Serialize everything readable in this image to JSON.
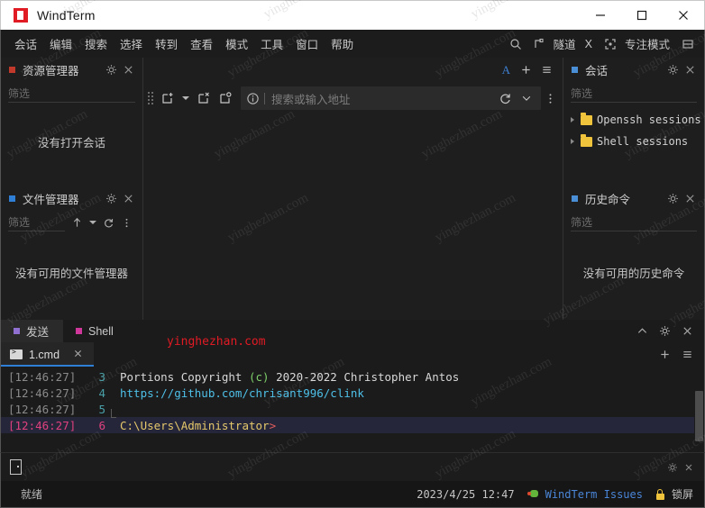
{
  "window": {
    "title": "WindTerm",
    "logo_icon": "windterm-logo-icon",
    "minimize_icon": "minimize-icon",
    "maximize_icon": "maximize-icon",
    "close_icon": "close-icon"
  },
  "menubar": {
    "items": [
      {
        "label": "会话"
      },
      {
        "label": "编辑"
      },
      {
        "label": "搜索"
      },
      {
        "label": "选择"
      },
      {
        "label": "转到"
      },
      {
        "label": "查看"
      },
      {
        "label": "模式"
      },
      {
        "label": "工具"
      },
      {
        "label": "窗口"
      },
      {
        "label": "帮助"
      }
    ],
    "right": {
      "search_icon": "search-icon",
      "tunnel_icon": "tunnel-icon",
      "tunnel_label": "隧道",
      "x_label": "X",
      "focus_icon": "focus-frame-icon",
      "focus_label": "专注模式",
      "layout_icon": "split-layout-icon"
    }
  },
  "explorer": {
    "title": "资源管理器",
    "dot_color": "#c0392b",
    "filter_placeholder": "筛选",
    "empty_text": "没有打开会话",
    "gear_icon": "gear-icon",
    "close_icon": "close-icon"
  },
  "file_manager": {
    "title": "文件管理器",
    "dot_color": "#2f7fd6",
    "filter_placeholder": "筛选",
    "empty_text": "没有可用的文件管理器",
    "gear_icon": "gear-icon",
    "close_icon": "close-icon",
    "up_icon": "arrow-up-icon",
    "dropdown_icon": "chevron-down-icon",
    "refresh_icon": "refresh-icon",
    "more_icon": "more-vertical-icon"
  },
  "sessions": {
    "title": "会话",
    "dot_color": "#2f7fd6",
    "filter_placeholder": "筛选",
    "gear_icon": "gear-icon",
    "close_icon": "close-icon",
    "items": [
      {
        "label": "Openssh sessions",
        "icon": "folder-icon",
        "expander": "chevron-right-icon"
      },
      {
        "label": "Shell sessions",
        "icon": "folder-icon",
        "expander": "chevron-right-icon"
      }
    ]
  },
  "history": {
    "title": "历史命令",
    "dot_color": "#2f7fd6",
    "filter_placeholder": "筛选",
    "empty_text": "没有可用的历史命令",
    "gear_icon": "gear-icon",
    "close_icon": "close-icon"
  },
  "toolbar": {
    "font_icon": "font-A-icon",
    "add_icon": "plus-icon",
    "menu_icon": "hamburger-menu-icon",
    "grip_icon": "drag-grip-icon",
    "new_session_icon": "new-session-icon",
    "new_session_dropdown_icon": "chevron-down-icon",
    "close_session_icon": "close-session-icon",
    "clone_session_icon": "clone-session-icon",
    "info_icon": "info-icon",
    "address_placeholder": "搜索或输入地址",
    "reload_icon": "reload-icon",
    "history_dropdown_icon": "chevron-down-icon",
    "more_icon": "more-vertical-icon"
  },
  "terminal_tabs": {
    "groups": [
      {
        "label": "发送",
        "dot_color": "#8f6fd0",
        "active": true
      },
      {
        "label": "Shell",
        "dot_color": "#d0379a",
        "active": false
      }
    ],
    "collapse_icon": "chevron-up-icon",
    "gear_icon": "gear-icon",
    "close_icon": "close-icon",
    "add_icon": "plus-icon",
    "menu_icon": "hamburger-menu-icon",
    "file_tab": {
      "label": "1.cmd",
      "icon": "cmd-icon",
      "close_icon": "close-icon"
    }
  },
  "terminal": {
    "lines": [
      {
        "timestamp": "[12:46:27]",
        "line_number": "3",
        "gutter": "top",
        "current": false,
        "segments": [
          {
            "text": "Portions Copyright ",
            "color": "#d8d8d8"
          },
          {
            "text": "(c)",
            "color": "#7fd06b"
          },
          {
            "text": " 2020-2022 Christopher Antos",
            "color": "#d8d8d8"
          }
        ]
      },
      {
        "timestamp": "[12:46:27]",
        "line_number": "4",
        "gutter": "mid",
        "current": false,
        "segments": [
          {
            "text": "https://github.com/chrisant996/clink",
            "color": "#4ec0e8"
          }
        ]
      },
      {
        "timestamp": "[12:46:27]",
        "line_number": "5",
        "gutter": "end",
        "current": false,
        "segments": [
          {
            "text": "",
            "color": "#d8d8d8"
          }
        ]
      },
      {
        "timestamp": "[12:46:27]",
        "line_number": "6",
        "gutter": "none",
        "current": true,
        "segments": [
          {
            "text": "C:\\Users\\Administrator",
            "color": "#e6c96b"
          },
          {
            "text": ">",
            "color": "#e05c5c"
          }
        ]
      }
    ]
  },
  "bottom_strip": {
    "panel_icon": "panel-toggle-icon",
    "gear_icon": "gear-icon",
    "close_icon": "close-icon"
  },
  "statusbar": {
    "ready_text": "就绪",
    "datetime": "2023/4/25 12:47",
    "issues_label": "WindTerm Issues",
    "issues_icon": "bug-icon",
    "lock_label": "锁屏",
    "lock_icon": "lock-icon",
    "link_color": "#4a86d8"
  },
  "watermarks": {
    "text": "yinghezhan.com",
    "red_text": "yinghezhan.com"
  }
}
